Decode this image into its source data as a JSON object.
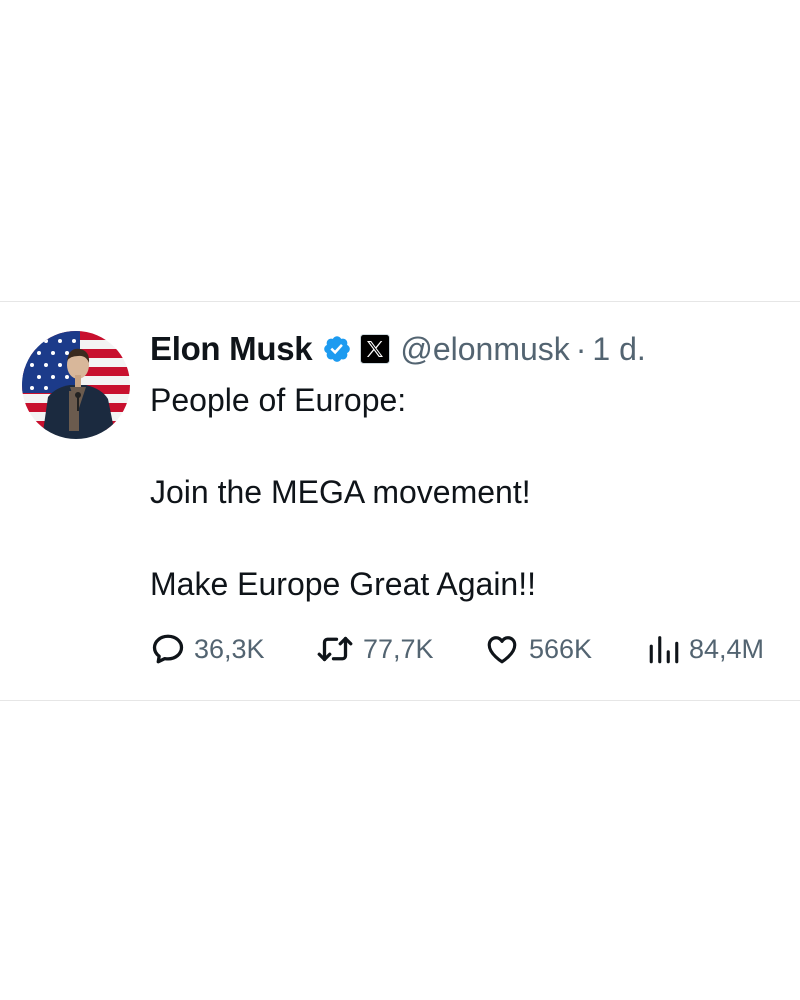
{
  "tweet": {
    "author": {
      "name": "Elon Musk",
      "handle": "@elonmusk",
      "separator": "·",
      "time": "1 d.",
      "verified": true,
      "affiliation_badge": "x-logo-icon"
    },
    "text": {
      "line1": "People of Europe:",
      "line2": "Join the MEGA movement!",
      "line3": "Make Europe Great Again!!"
    },
    "stats": {
      "replies": "36,3K",
      "retweets": "77,7K",
      "likes": "566K",
      "views": "84,4M"
    }
  },
  "colors": {
    "text": "#0f1419",
    "secondary": "#536471",
    "verified": "#1d9bf0",
    "divider": "#e6e6e6"
  }
}
